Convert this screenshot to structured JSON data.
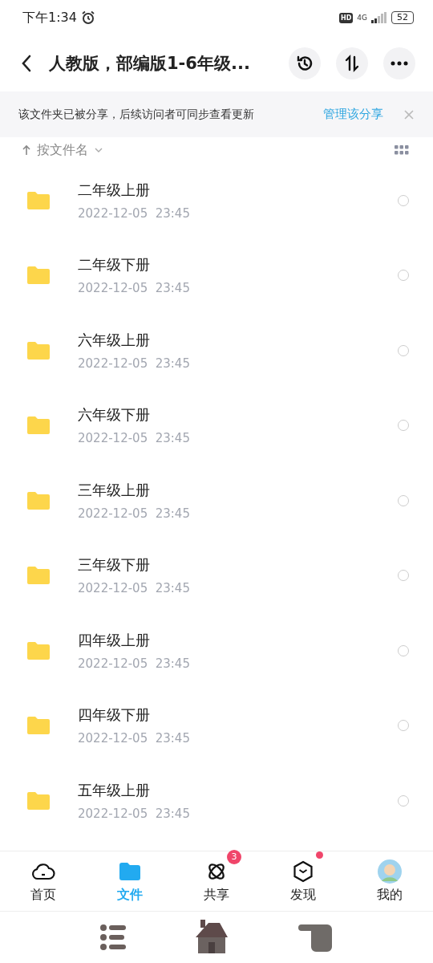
{
  "status_bar": {
    "time": "下午1:34",
    "hd": "HD",
    "network": "4G",
    "battery": "52"
  },
  "header": {
    "title": "人教版，部编版1-6年级..."
  },
  "share_banner": {
    "message": "该文件夹已被分享，后续访问者可同步查看更新",
    "action": "管理该分享"
  },
  "sort": {
    "label": "按文件名"
  },
  "files": [
    {
      "name": "二年级上册",
      "date": "2022-12-05  23:45",
      "selected": false
    },
    {
      "name": "二年级下册",
      "date": "2022-12-05  23:45",
      "selected": false
    },
    {
      "name": "六年级上册",
      "date": "2022-12-05  23:45",
      "selected": false
    },
    {
      "name": "六年级下册",
      "date": "2022-12-05  23:45",
      "selected": false
    },
    {
      "name": "三年级上册",
      "date": "2022-12-05  23:45",
      "selected": false
    },
    {
      "name": "三年级下册",
      "date": "2022-12-05  23:45",
      "selected": false
    },
    {
      "name": "四年级上册",
      "date": "2022-12-05  23:45",
      "selected": false
    },
    {
      "name": "四年级下册",
      "date": "2022-12-05  23:45",
      "selected": false
    },
    {
      "name": "五年级上册",
      "date": "2022-12-05  23:45",
      "selected": false
    }
  ],
  "tabs": [
    {
      "label": "首页",
      "kind": "home",
      "selected": false
    },
    {
      "label": "文件",
      "kind": "files",
      "selected": true
    },
    {
      "label": "共享",
      "kind": "share",
      "selected": false,
      "badge": "3"
    },
    {
      "label": "发现",
      "kind": "discover",
      "selected": false,
      "dot": true
    },
    {
      "label": "我的",
      "kind": "me",
      "selected": false
    }
  ]
}
